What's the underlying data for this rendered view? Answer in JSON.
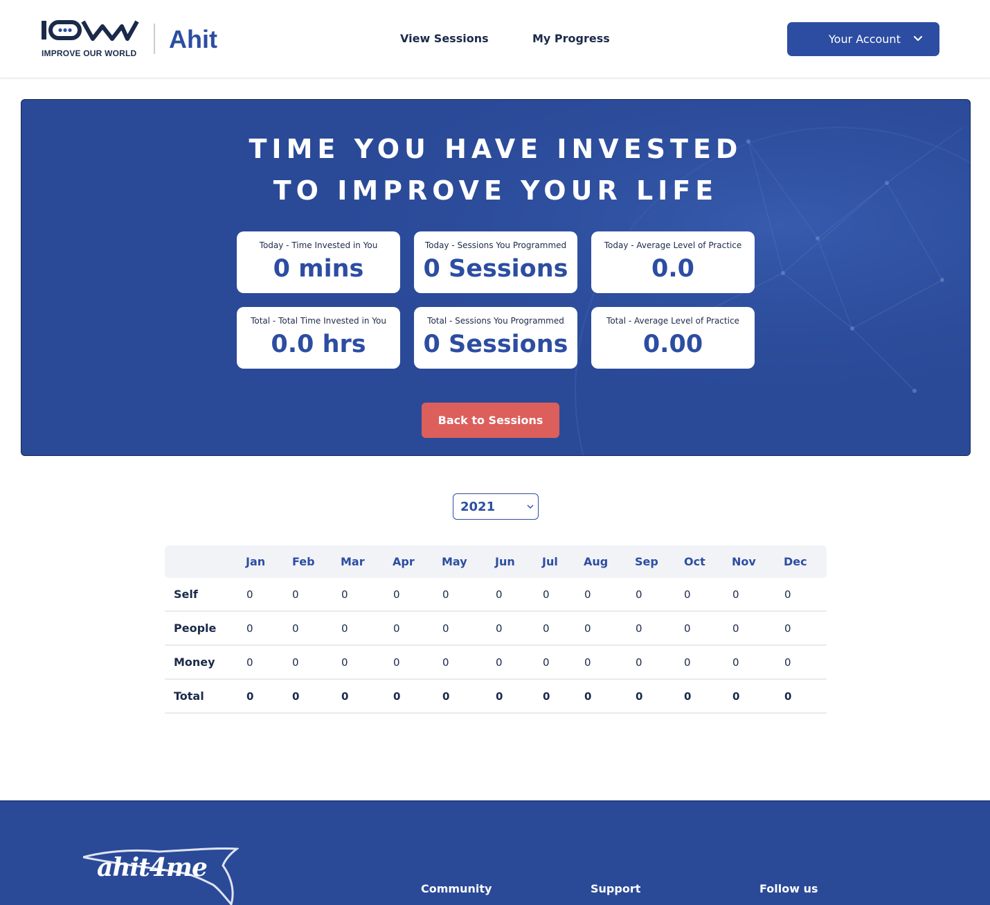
{
  "header": {
    "logo_text": "IOW",
    "logo_sub": "IMPROVE OUR WORLD",
    "brand": "Ahit",
    "nav": {
      "view_sessions": "View Sessions",
      "my_progress": "My Progress"
    },
    "account_label": "Your Account"
  },
  "hero": {
    "title_line1": "TIME YOU HAVE INVESTED",
    "title_line2": "TO IMPROVE YOUR LIFE",
    "cards": [
      {
        "label": "Today - Time Invested in You",
        "value": "0 mins"
      },
      {
        "label": "Today - Sessions You Programmed",
        "value": "0 Sessions"
      },
      {
        "label": "Today - Average Level of Practice",
        "value": "0.0"
      },
      {
        "label": "Total - Total Time Invested in You",
        "value": "0.0 hrs"
      },
      {
        "label": "Total - Sessions You Programmed",
        "value": "0 Sessions"
      },
      {
        "label": "Total - Average Level of Practice",
        "value": "0.00"
      }
    ],
    "back_button": "Back to Sessions"
  },
  "year_select": {
    "value": "2021"
  },
  "table": {
    "months": [
      "Jan",
      "Feb",
      "Mar",
      "Apr",
      "May",
      "Jun",
      "Jul",
      "Aug",
      "Sep",
      "Oct",
      "Nov",
      "Dec"
    ],
    "rows": [
      {
        "label": "Self",
        "values": [
          "0",
          "0",
          "0",
          "0",
          "0",
          "0",
          "0",
          "0",
          "0",
          "0",
          "0",
          "0"
        ]
      },
      {
        "label": "People",
        "values": [
          "0",
          "0",
          "0",
          "0",
          "0",
          "0",
          "0",
          "0",
          "0",
          "0",
          "0",
          "0"
        ]
      },
      {
        "label": "Money",
        "values": [
          "0",
          "0",
          "0",
          "0",
          "0",
          "0",
          "0",
          "0",
          "0",
          "0",
          "0",
          "0"
        ]
      },
      {
        "label": "Total",
        "values": [
          "0",
          "0",
          "0",
          "0",
          "0",
          "0",
          "0",
          "0",
          "0",
          "0",
          "0",
          "0"
        ]
      }
    ]
  },
  "footer": {
    "logo_text": "ahit4me",
    "community": "Community",
    "support": "Support",
    "follow_us": "Follow us"
  },
  "colors": {
    "brand_blue": "#2c4da1",
    "hero_bg": "#2a4a98",
    "accent_red": "#dc5f5c"
  }
}
